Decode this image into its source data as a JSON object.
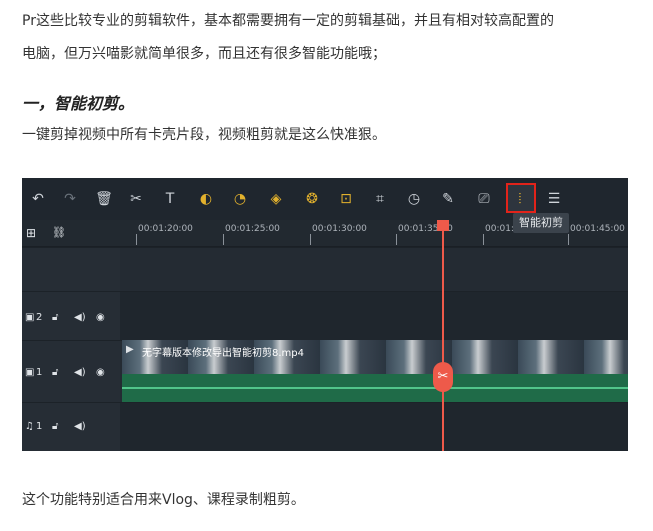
{
  "text": {
    "line1": "Pr这些比较专业的剪辑软件，基本都需要拥有一定的剪辑基础，并且有相对较高配置的",
    "line2": "电脑，但万兴喵影就简单很多，而且还有很多智能功能哦；",
    "heading": "一，智能初剪。",
    "line3": "一键剪掉视频中所有卡壳片段，视频粗剪就是这么快准狠。",
    "line4": "这个功能特别适合用来Vlog、课程录制粗剪。"
  },
  "editor": {
    "toolbar": [
      {
        "name": "undo-icon",
        "glyph": "↶",
        "state": "normal"
      },
      {
        "name": "redo-icon",
        "glyph": "↷",
        "state": "dim"
      },
      {
        "name": "delete-icon",
        "glyph": "🗑",
        "state": "normal"
      },
      {
        "name": "scissors-icon",
        "glyph": "✂",
        "state": "normal"
      },
      {
        "name": "text-icon",
        "glyph": "T",
        "state": "normal"
      },
      {
        "name": "speed-icon",
        "glyph": "◐",
        "state": "gold"
      },
      {
        "name": "audio-icon",
        "glyph": "◔",
        "state": "gold"
      },
      {
        "name": "keyframe-icon",
        "glyph": "◈",
        "state": "gold"
      },
      {
        "name": "color-icon",
        "glyph": "❂",
        "state": "gold"
      },
      {
        "name": "ai-cutout-icon",
        "glyph": "⊡",
        "state": "gold"
      },
      {
        "name": "crop-icon",
        "glyph": "⌗",
        "state": "normal"
      },
      {
        "name": "timer-icon",
        "glyph": "◷",
        "state": "normal"
      },
      {
        "name": "pen-icon",
        "glyph": "✎",
        "state": "normal"
      },
      {
        "name": "snapshot-icon",
        "glyph": "⎚",
        "state": "normal"
      },
      {
        "name": "smart-trim-icon",
        "glyph": "⦙",
        "state": "gold"
      },
      {
        "name": "settings-sliders-icon",
        "glyph": "☰",
        "state": "normal"
      }
    ],
    "tooltip": "智能初剪",
    "ruler": {
      "add-track-icon": "⊞",
      "link-icon": "⛓",
      "ticks": [
        "00:01:20:00",
        "00:01:25:00",
        "00:01:30:00",
        "00:01:35:00",
        "00:01:4",
        "00:01:45:00"
      ]
    },
    "tracks": [
      {
        "label": "2",
        "type": "video"
      },
      {
        "label": "1",
        "type": "video"
      },
      {
        "label": "1",
        "type": "audio"
      }
    ],
    "clip_title": "无字幕版本修改导出智能初剪8.mp4",
    "colors": {
      "accent": "#e2b12d",
      "highlight": "#e2231a",
      "playhead": "#ee5a4a"
    }
  }
}
